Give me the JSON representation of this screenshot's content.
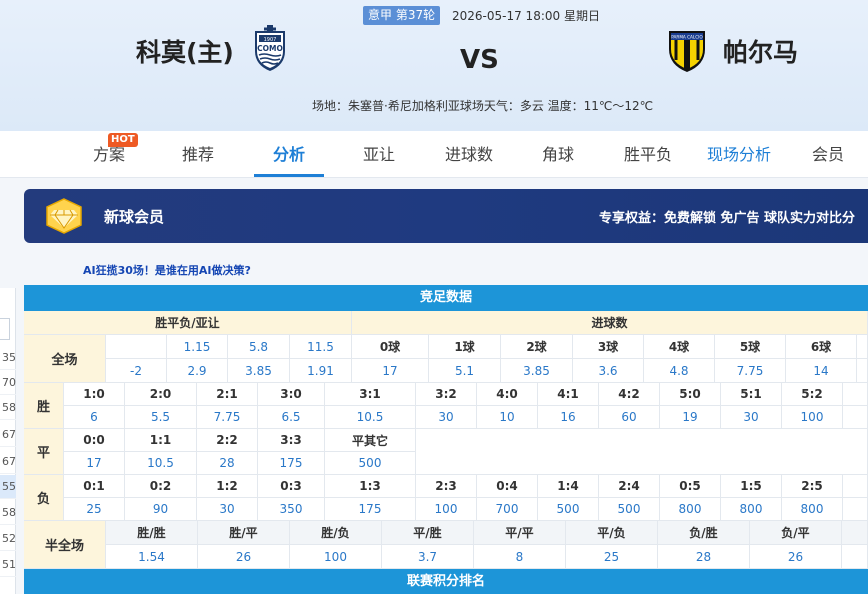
{
  "match": {
    "round_badge": "意甲 第37轮",
    "time": "2026-05-17 18:00 星期日",
    "home": "科莫(主)",
    "away": "帕尔马",
    "vs": "VS",
    "venue": "场地：朱塞普·希尼加格利亚球场天气：多云 温度：11℃～12℃",
    "home_logo_text": "1907 COMO",
    "away_logo_text": "PARMA CALCIO",
    "colors": {
      "home_logo": "#1b3a6b",
      "away_logo": "#f5d200"
    }
  },
  "tabs": {
    "items": [
      {
        "label": "方案"
      },
      {
        "label": "推荐"
      },
      {
        "label": "分析"
      },
      {
        "label": "亚让"
      },
      {
        "label": "进球数"
      },
      {
        "label": "角球"
      },
      {
        "label": "胜平负"
      },
      {
        "label": "现场分析"
      },
      {
        "label": "会员"
      }
    ],
    "active": "分析",
    "hot_badge": "HOT",
    "accent": "#1e7fd6"
  },
  "left_strip": {
    "values": [
      "35",
      "70",
      "58",
      "67",
      "67",
      "55",
      "58",
      "52",
      "51"
    ]
  },
  "vip": {
    "title": "新球会员",
    "perks": "专享权益：免费解锁 免广告 球队实力对比分",
    "icon": "diamond-badge-icon"
  },
  "ai_link": "AI狂揽30场！是谁在用AI做决策?",
  "odds": {
    "title": "竞足数据",
    "spf_header": "胜平负/亚让",
    "goals_header": "进球数",
    "row_full_label": "全场",
    "spf_top": [
      "",
      "1.15",
      "5.8",
      "11.5"
    ],
    "spf_bottom": [
      "-2",
      "2.9",
      "3.85",
      "1.91"
    ],
    "goal_labels": [
      "0球",
      "1球",
      "2球",
      "3球",
      "4球",
      "5球",
      "6球"
    ],
    "goal_values": [
      "17",
      "5.1",
      "3.85",
      "3.6",
      "4.8",
      "7.75",
      "14"
    ],
    "win_label": "胜",
    "win_scores": [
      "1:0",
      "2:0",
      "2:1",
      "3:0",
      "3:1",
      "3:2",
      "4:0",
      "4:1",
      "4:2",
      "5:0",
      "5:1",
      "5:2"
    ],
    "win_odds": [
      "6",
      "5.5",
      "7.75",
      "6.5",
      "10.5",
      "30",
      "10",
      "16",
      "60",
      "19",
      "30",
      "100"
    ],
    "draw_label": "平",
    "draw_scores": [
      "0:0",
      "1:1",
      "2:2",
      "3:3",
      "平其它"
    ],
    "draw_odds": [
      "17",
      "10.5",
      "28",
      "175",
      "500"
    ],
    "loss_label": "负",
    "loss_scores": [
      "0:1",
      "0:2",
      "1:2",
      "0:3",
      "1:3",
      "2:3",
      "0:4",
      "1:4",
      "2:4",
      "0:5",
      "1:5",
      "2:5"
    ],
    "loss_odds": [
      "25",
      "90",
      "30",
      "350",
      "175",
      "100",
      "700",
      "500",
      "500",
      "800",
      "800",
      "800"
    ],
    "half_label": "半全场",
    "half_labels": [
      "胜/胜",
      "胜/平",
      "胜/负",
      "平/胜",
      "平/平",
      "平/负",
      "负/胜",
      "负/平"
    ],
    "half_odds": [
      "1.54",
      "26",
      "100",
      "3.7",
      "8",
      "25",
      "28",
      "26"
    ],
    "league_title": "联赛积分排名"
  }
}
